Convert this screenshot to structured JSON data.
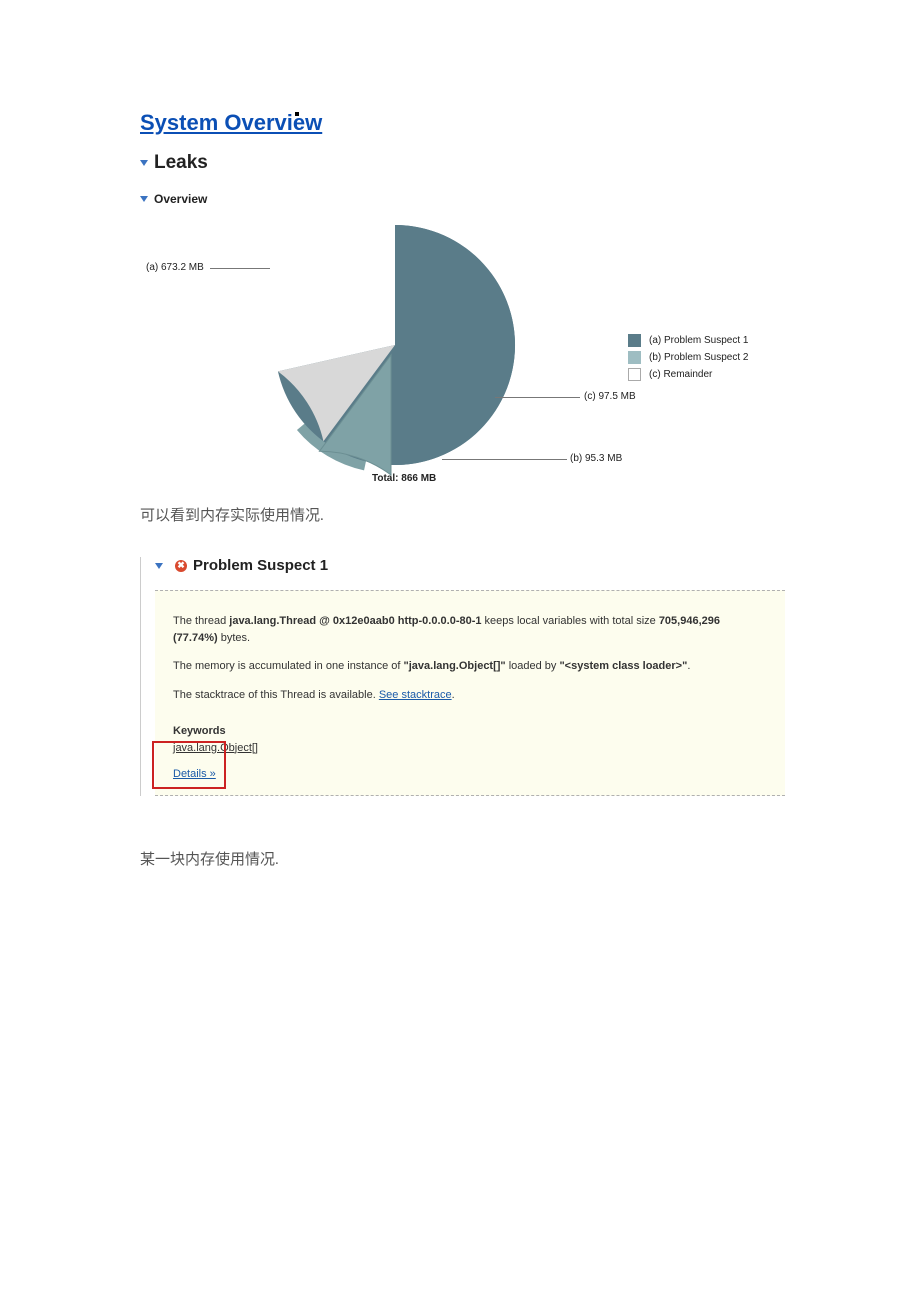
{
  "title": "System Overview",
  "leaks_heading": "Leaks",
  "overview_heading": "Overview",
  "chart_data": {
    "type": "pie",
    "title": "",
    "total_label": "Total: 866 MB",
    "series": [
      {
        "name": "(a) Problem Suspect 1",
        "value_mb": 673.2,
        "label": "(a) 673.2 MB",
        "color": "#5a7c89"
      },
      {
        "name": "(b) Problem Suspect 2",
        "value_mb": 95.3,
        "label": "(b) 95.3 MB",
        "color": "#7fa2a6"
      },
      {
        "name": "(c) Remainder",
        "value_mb": 97.5,
        "label": "(c) 97.5 MB",
        "color": "#d8d8d8"
      }
    ],
    "legend": [
      "(a) Problem Suspect 1",
      "(b) Problem Suspect 2",
      "(c) Remainder"
    ]
  },
  "caption1": "可以看到内存实际使用情况.",
  "suspect": {
    "title": "Problem Suspect 1",
    "line1_pre": "The thread ",
    "line1_bold1": "java.lang.Thread @ 0x12e0aab0 http-0.0.0.0-80-1",
    "line1_mid": " keeps local variables with total size ",
    "line1_bold2": "705,946,296 (77.74%)",
    "line1_post": " bytes.",
    "line2_pre": "The memory is accumulated in one instance of ",
    "line2_bold1": "\"java.lang.Object[]\"",
    "line2_mid": " loaded by ",
    "line2_bold2": "\"<system class loader>\"",
    "line2_post": ".",
    "line3_pre": "The stacktrace of this Thread is available. ",
    "line3_link": "See stacktrace",
    "line3_post": ".",
    "keywords_heading": "Keywords",
    "keywords_value": "java.lang.Object[]",
    "details_link": "Details »"
  },
  "caption2": "某一块内存使用情况."
}
